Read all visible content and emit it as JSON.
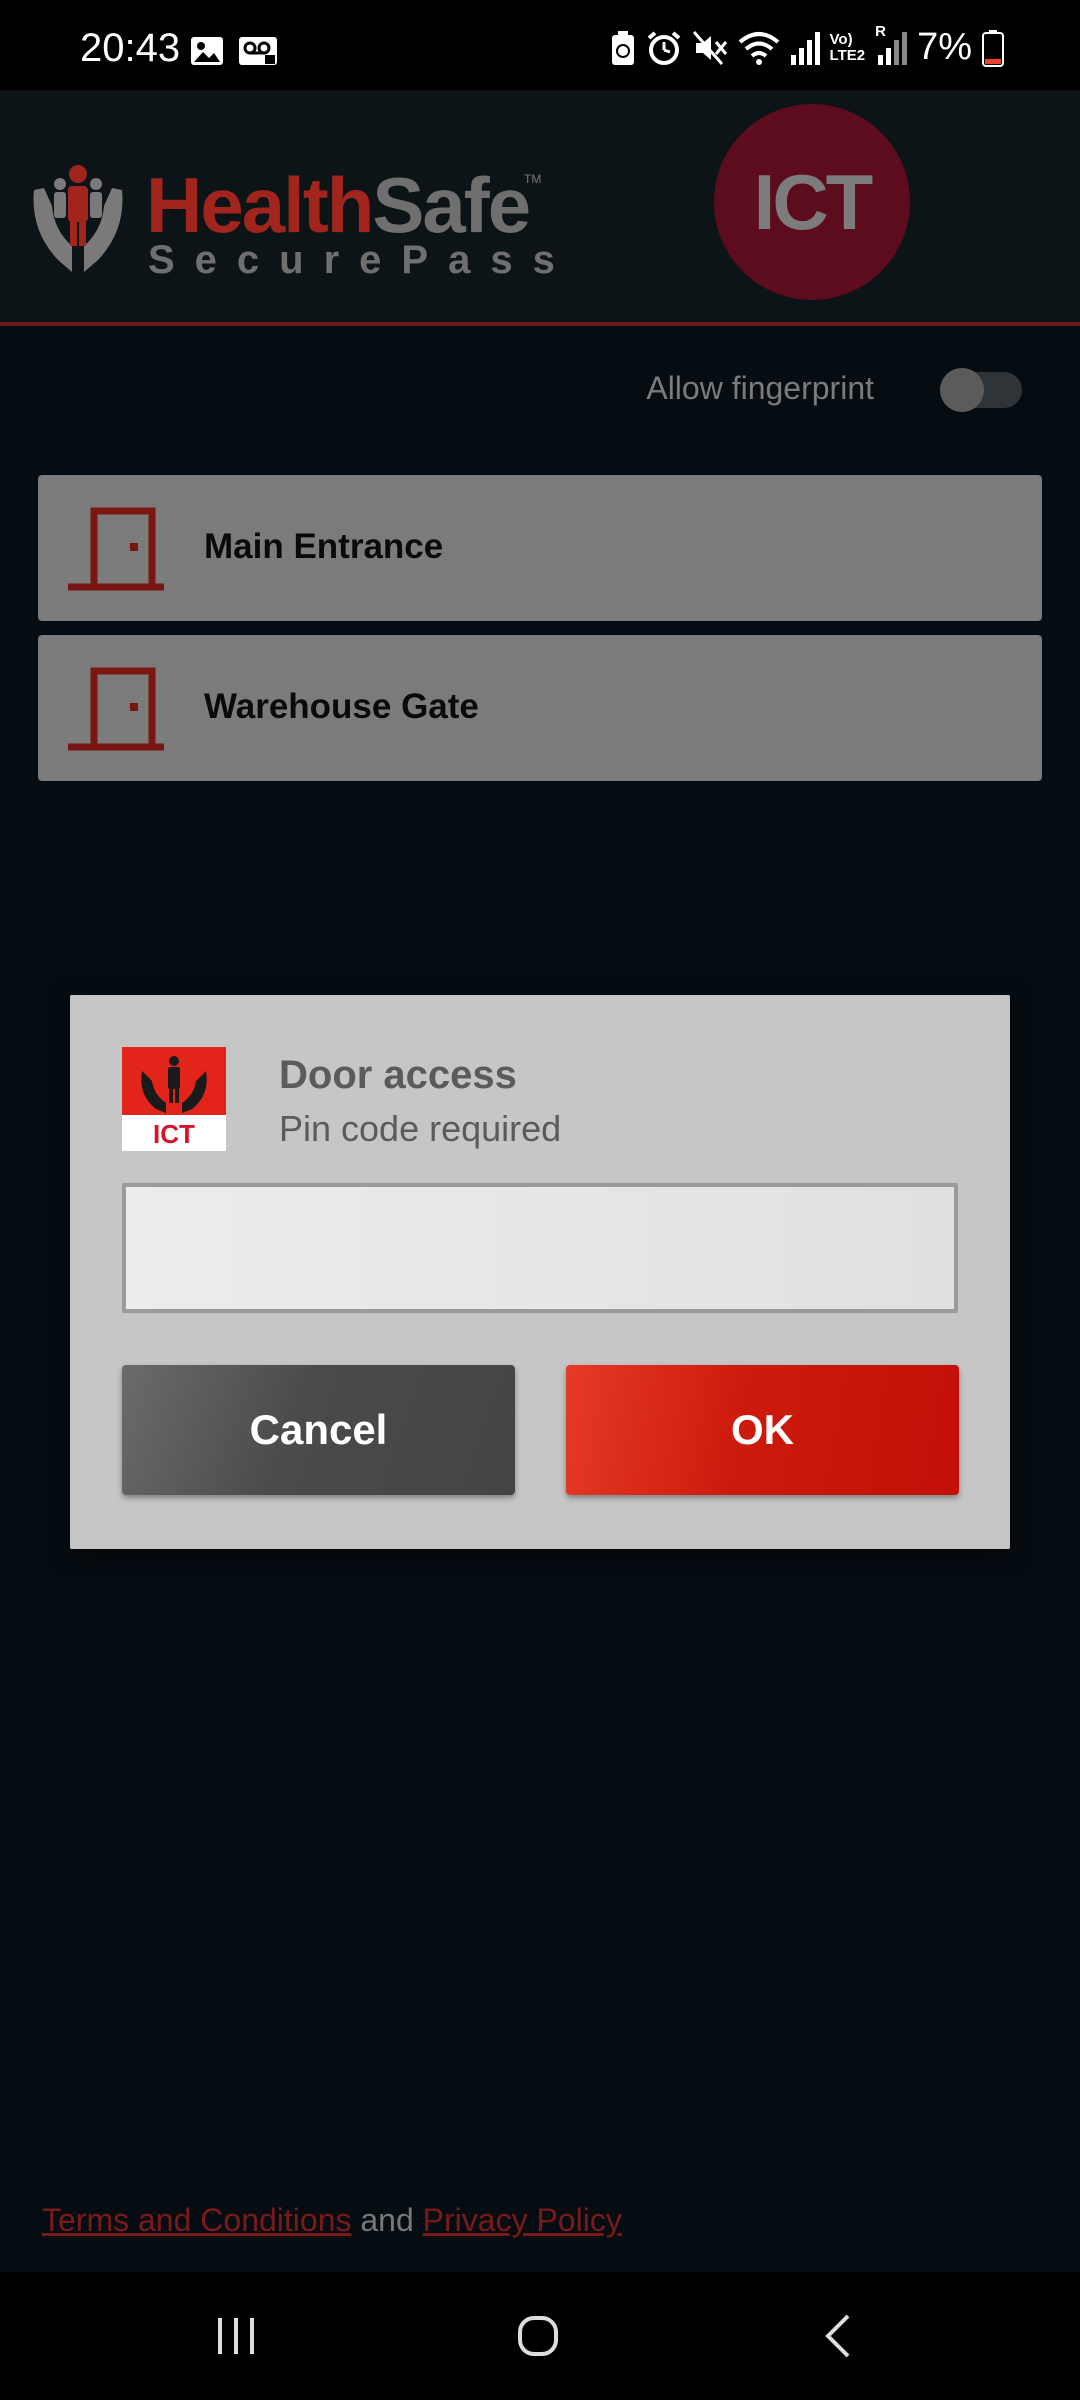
{
  "status_bar": {
    "time": "20:43",
    "battery": "7%",
    "network_label_top": "Vo)",
    "network_label_bottom": "LTE2",
    "roaming": "R",
    "icons": [
      "image-icon",
      "voicemail-icon",
      "battery-saver-icon",
      "alarm-icon",
      "mute-icon",
      "wifi-icon",
      "signal-icon",
      "signal-icon-2",
      "battery-icon"
    ]
  },
  "header": {
    "logo_health": "Health",
    "logo_safe": "Safe",
    "logo_tm": "TM",
    "logo_securepass": "SecurePass",
    "badge_text": "ICT"
  },
  "settings": {
    "fingerprint_label": "Allow fingerprint",
    "fingerprint_enabled": false
  },
  "doors": [
    {
      "label": "Main Entrance"
    },
    {
      "label": "Warehouse Gate"
    }
  ],
  "dialog": {
    "icon_text": "ICT",
    "title": "Door access",
    "subtitle": "Pin code required",
    "pin_value": "",
    "cancel_label": "Cancel",
    "ok_label": "OK"
  },
  "footer": {
    "terms_label": "Terms and Conditions",
    "and_text": " and ",
    "privacy_label": "Privacy Policy"
  },
  "colors": {
    "brand_red": "#a1251c",
    "ok_red": "#d8200f",
    "badge_maroon": "#5c0c1c",
    "background": "#060d12"
  }
}
